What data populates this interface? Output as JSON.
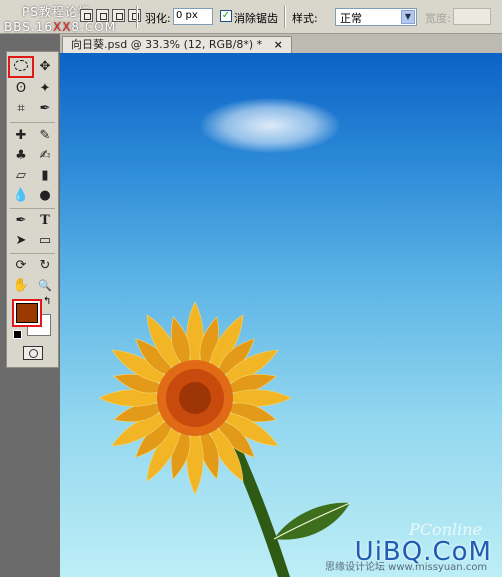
{
  "watermark_top": {
    "line1": "PS教程论坛",
    "line2_prefix": "BBS.16",
    "line2_highlight": "XX",
    "line2_suffix": "8.COM"
  },
  "options_bar": {
    "feather_label": "羽化:",
    "feather_value": "0 px",
    "antialias_label": "消除锯齿",
    "antialias_checked": true,
    "style_label": "样式:",
    "style_value": "正常",
    "width_label": "宽度:"
  },
  "document": {
    "tab_title": "向日葵.psd @ 33.3% (12, RGB/8*) *",
    "close_glyph": "×"
  },
  "tools": {
    "move": "✥",
    "lasso": "ʘ",
    "magic_wand": "✦",
    "crop": "⌗",
    "eyedropper": "✒",
    "healing": "✚",
    "brush": "✎",
    "stamp": "♣",
    "history_brush": "✍",
    "eraser": "▱",
    "gradient": "▮",
    "blur": "💧",
    "dodge": "●",
    "pen": "✒",
    "type": "T",
    "path_select": "➤",
    "shape": "▭",
    "3d_rotate": "⟳",
    "3d_orbit": "↻",
    "hand": "✋",
    "zoom": "🔍",
    "swap": "↰"
  },
  "colors": {
    "foreground": "#9b3a00",
    "background": "#ffffff",
    "highlight": "#e01818"
  },
  "canvas": {
    "brand": "UiBQ.CoM",
    "pconline": "PConline",
    "footer_watermark": "思缘设计论坛 www.missyuan.com"
  }
}
